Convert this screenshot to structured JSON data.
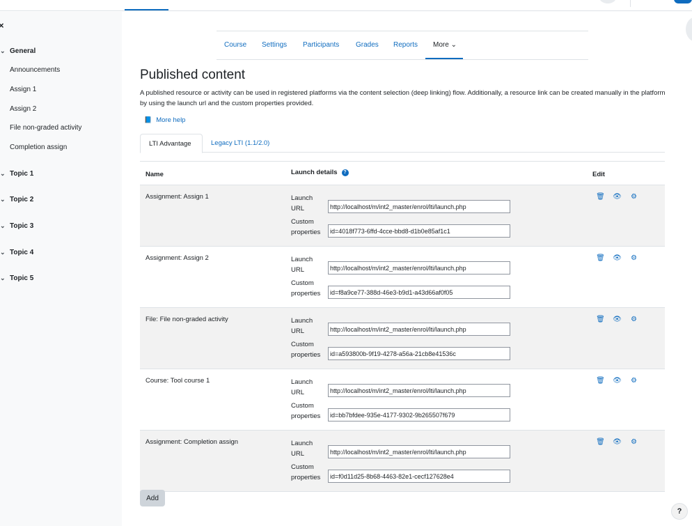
{
  "drawer": {
    "close_glyph": "×",
    "sections": [
      {
        "label": "General",
        "items": [
          "Announcements",
          "Assign 1",
          "Assign 2",
          "File non-graded activity",
          "Completion assign"
        ]
      },
      {
        "label": "Topic 1"
      },
      {
        "label": "Topic 2"
      },
      {
        "label": "Topic 3"
      },
      {
        "label": "Topic 4"
      },
      {
        "label": "Topic 5"
      }
    ]
  },
  "secondary_nav": [
    "Course",
    "Settings",
    "Participants",
    "Grades",
    "Reports",
    "More"
  ],
  "page": {
    "title": "Published content",
    "intro": "A published resource or activity can be used in registered platforms via the content selection (deep linking) flow. Additionally, a resource link can be created manually in the platform by using the launch url and the custom properties provided.",
    "more_help": "More help"
  },
  "tabs": [
    "LTI Advantage",
    "Legacy LTI (1.1/2.0)"
  ],
  "table": {
    "headers": {
      "name": "Name",
      "launch": "Launch details",
      "edit": "Edit"
    },
    "launch_label": "Launch URL",
    "custom_label": "Custom properties",
    "rows": [
      {
        "name": "Assignment: Assign 1",
        "url": "http://localhost/m/int2_master/enrol/lti/launch.php",
        "custom": "id=4018f773-6ffd-4cce-bbd8-d1b0e85af1c1"
      },
      {
        "name": "Assignment: Assign 2",
        "url": "http://localhost/m/int2_master/enrol/lti/launch.php",
        "custom": "id=f8a9ce77-388d-46e3-b9d1-a43d66af0f05"
      },
      {
        "name": "File: File non-graded activity",
        "url": "http://localhost/m/int2_master/enrol/lti/launch.php",
        "custom": "id=a593800b-9f19-4278-a56a-21cb8e41536c"
      },
      {
        "name": "Course: Tool course 1",
        "url": "http://localhost/m/int2_master/enrol/lti/launch.php",
        "custom": "id=bb7bfdee-935e-4177-9302-9b265507f679"
      },
      {
        "name": "Assignment: Completion assign",
        "url": "http://localhost/m/int2_master/enrol/lti/launch.php",
        "custom": "id=f0d11d25-8b68-4463-82e1-cecf127628e4"
      }
    ]
  },
  "buttons": {
    "add": "Add",
    "help": "?"
  },
  "colors": {
    "accent": "#0f6cbf",
    "drawer_bg": "#f8f9fa",
    "row_stripe": "#f2f2f2"
  }
}
